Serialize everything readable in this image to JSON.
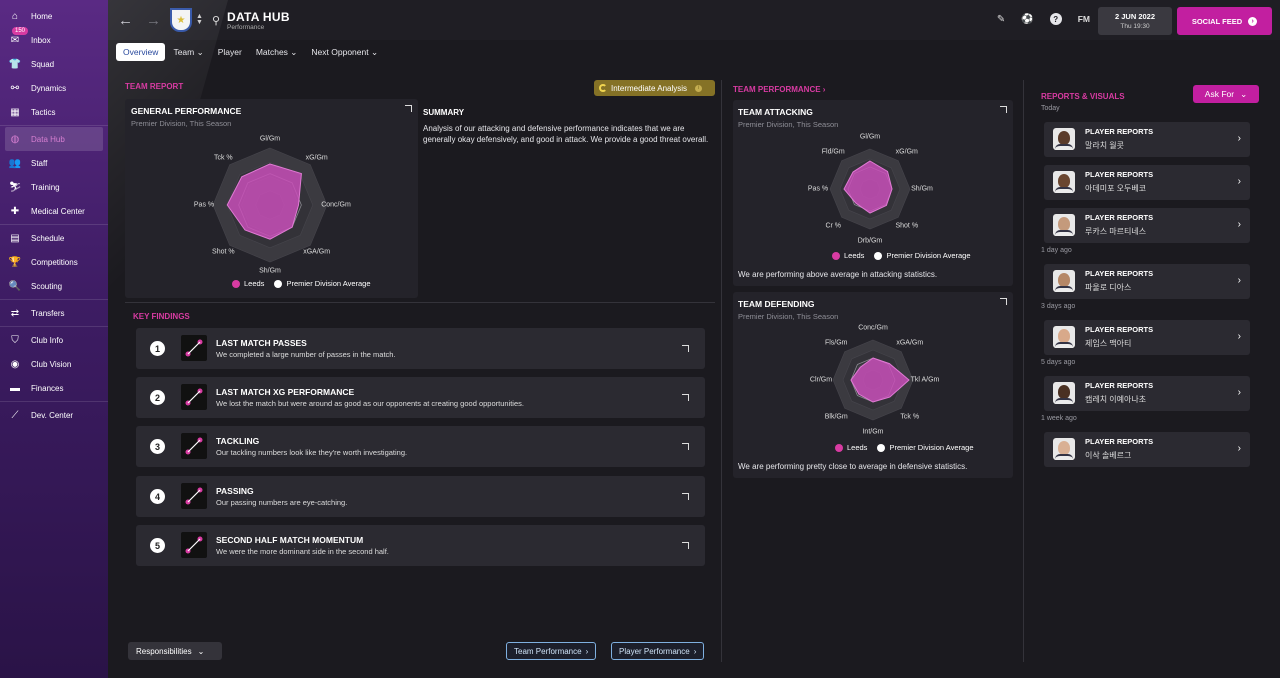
{
  "sidebar": {
    "items": [
      {
        "label": "Home",
        "icon": "home-icon",
        "glyph": "⌂"
      },
      {
        "label": "Inbox",
        "icon": "inbox-icon",
        "glyph": "✉",
        "badge": "150"
      },
      {
        "label": "Squad",
        "icon": "shirt-icon",
        "glyph": "👕"
      },
      {
        "label": "Dynamics",
        "icon": "dynamics-icon",
        "glyph": "⚯"
      },
      {
        "label": "Tactics",
        "icon": "tactics-icon",
        "glyph": "▦"
      },
      {
        "label": "Data Hub",
        "icon": "data-hub-icon",
        "glyph": "◍",
        "active": true
      },
      {
        "label": "Staff",
        "icon": "staff-icon",
        "glyph": "👥"
      },
      {
        "label": "Training",
        "icon": "training-icon",
        "glyph": "⛷"
      },
      {
        "label": "Medical Center",
        "icon": "medical-icon",
        "glyph": "✚"
      },
      {
        "label": "Schedule",
        "icon": "calendar-icon",
        "glyph": "▤"
      },
      {
        "label": "Competitions",
        "icon": "trophy-icon",
        "glyph": "🏆"
      },
      {
        "label": "Scouting",
        "icon": "scouting-icon",
        "glyph": "🔍"
      },
      {
        "label": "Transfers",
        "icon": "transfers-icon",
        "glyph": "⇄"
      },
      {
        "label": "Club Info",
        "icon": "club-info-icon",
        "glyph": "⛉"
      },
      {
        "label": "Club Vision",
        "icon": "club-vision-icon",
        "glyph": "◉"
      },
      {
        "label": "Finances",
        "icon": "finances-icon",
        "glyph": "▬"
      },
      {
        "label": "Dev. Center",
        "icon": "dev-center-icon",
        "glyph": "⟋"
      }
    ]
  },
  "topbar": {
    "title": "DATA HUB",
    "subtitle": "Performance",
    "date": "2 JUN 2022",
    "time": "Thu 19:30",
    "fm": "FM",
    "help": "?",
    "social": "SOCIAL FEED"
  },
  "tabs": [
    {
      "label": "Overview",
      "selected": true
    },
    {
      "label": "Team",
      "dropdown": true
    },
    {
      "label": "Player"
    },
    {
      "label": "Matches",
      "dropdown": true
    },
    {
      "label": "Next Opponent",
      "dropdown": true
    }
  ],
  "team_report": {
    "section": "TEAM REPORT",
    "analysis_level": "Intermediate Analysis",
    "general": {
      "title": "GENERAL PERFORMANCE",
      "subtitle": "Premier Division, This Season",
      "axes": [
        "Gl/Gm",
        "xG/Gm",
        "Conc/Gm",
        "xGA/Gm",
        "Sh/Gm",
        "Shot %",
        "Pas %",
        "Tck %"
      ],
      "leeds": [
        0.72,
        0.78,
        0.5,
        0.55,
        0.6,
        0.62,
        0.75,
        0.7
      ],
      "legend_team": "Leeds",
      "legend_avg": "Premier Division Average"
    },
    "summary": {
      "heading": "SUMMARY",
      "body": "Analysis of our attacking and defensive performance indicates that we are generally okay defensively, and good in attack. We provide a good threat overall."
    }
  },
  "key_findings": {
    "section": "KEY FINDINGS",
    "items": [
      {
        "num": "1",
        "title": "LAST MATCH PASSES",
        "desc": "We completed a large number of passes in the match.",
        "icon": "passes-icon"
      },
      {
        "num": "2",
        "title": "LAST MATCH XG PERFORMANCE",
        "desc": "We lost the match but were around as good as our opponents at creating good opportunities.",
        "icon": "xg-icon"
      },
      {
        "num": "3",
        "title": "TACKLING",
        "desc": "Our tackling numbers look like they're worth investigating.",
        "icon": "tackling-icon"
      },
      {
        "num": "4",
        "title": "PASSING",
        "desc": "Our passing numbers are eye-catching.",
        "icon": "passing-icon"
      },
      {
        "num": "5",
        "title": "SECOND HALF MATCH MOMENTUM",
        "desc": "We were the more dominant side in the second half.",
        "icon": "momentum-icon"
      }
    ]
  },
  "footer": {
    "responsibilities": "Responsibilities",
    "team_perf_btn": "Team Performance",
    "player_perf_btn": "Player Performance"
  },
  "team_performance": {
    "section": "TEAM PERFORMANCE",
    "attacking": {
      "title": "TEAM ATTACKING",
      "subtitle": "Premier Division, This Season",
      "axes": [
        "Gl/Gm",
        "xG/Gm",
        "Sh/Gm",
        "Shot %",
        "Drb/Gm",
        "Cr %",
        "Pas %",
        "Fld/Gm"
      ],
      "leeds": [
        0.7,
        0.62,
        0.55,
        0.58,
        0.6,
        0.5,
        0.65,
        0.6
      ],
      "note": "We are performing above average in attacking statistics.",
      "legend_team": "Leeds",
      "legend_avg": "Premier Division Average"
    },
    "defending": {
      "title": "TEAM DEFENDING",
      "subtitle": "Premier Division, This Season",
      "axes": [
        "Conc/Gm",
        "xGA/Gm",
        "Tkl A/Gm",
        "Tck %",
        "Int/Gm",
        "Blk/Gm",
        "Clr/Gm",
        "Fls/Gm"
      ],
      "leeds": [
        0.55,
        0.58,
        0.9,
        0.6,
        0.55,
        0.5,
        0.55,
        0.45
      ],
      "note": "We are performing pretty close to average in defensive statistics.",
      "legend_team": "Leeds",
      "legend_avg": "Premier Division Average"
    }
  },
  "reports": {
    "section": "REPORTS & VISUALS",
    "ask_for": "Ask For",
    "groups": [
      {
        "day": "Today",
        "items": [
          {
            "title": "PLAYER REPORTS",
            "name": "말라치 월콧",
            "skin": "#5a3b2a"
          },
          {
            "title": "PLAYER REPORTS",
            "name": "아데미포 오두베코",
            "skin": "#6a4630"
          },
          {
            "title": "PLAYER REPORTS",
            "name": "루카스 마르티네스",
            "skin": "#c49a7c"
          }
        ]
      },
      {
        "day": "1 day ago",
        "items": [
          {
            "title": "PLAYER REPORTS",
            "name": "파울로 디아스",
            "skin": "#b58766"
          }
        ]
      },
      {
        "day": "3 days ago",
        "items": [
          {
            "title": "PLAYER REPORTS",
            "name": "제임스 맥아티",
            "skin": "#d8a98a"
          }
        ]
      },
      {
        "day": "5 days ago",
        "items": [
          {
            "title": "PLAYER REPORTS",
            "name": "캠레치 이예아나초",
            "skin": "#4a3022"
          }
        ]
      },
      {
        "day": "1 week ago",
        "items": [
          {
            "title": "PLAYER REPORTS",
            "name": "이삭 솔베르그",
            "skin": "#d9b094"
          }
        ]
      }
    ]
  },
  "colors": {
    "accent": "#d83ba2",
    "team_fill": "#c84fb8",
    "avg_ring": "#3b3a40"
  }
}
